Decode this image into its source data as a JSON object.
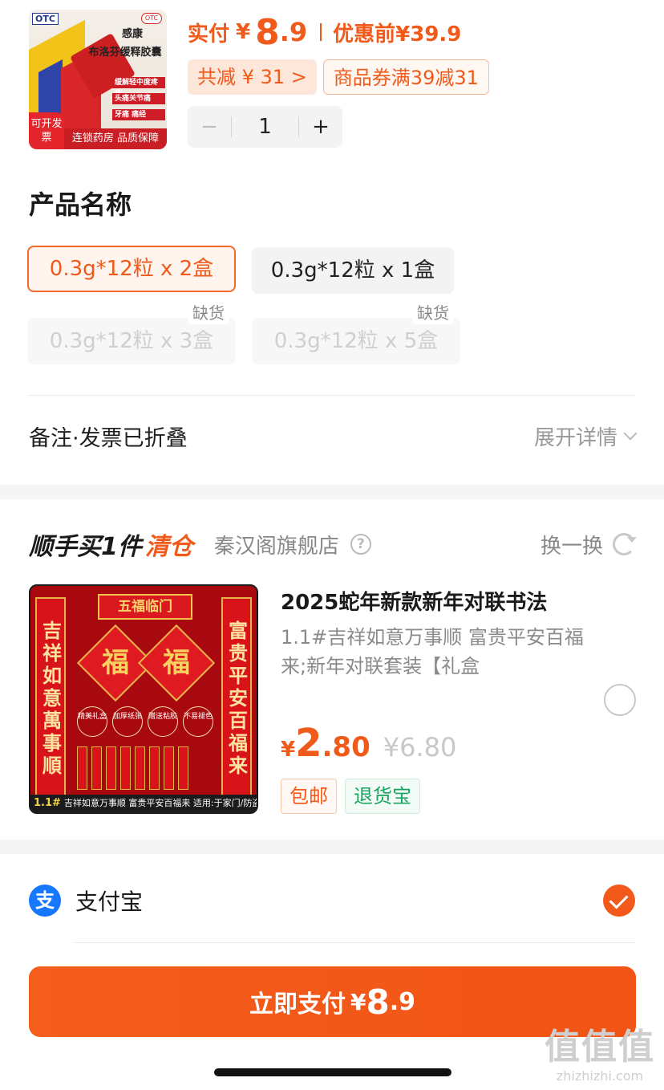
{
  "product": {
    "thumb": {
      "otc": "OTC",
      "brand": "感康",
      "name": "布洛芬缓释胶囊",
      "tags": [
        "缓解轻中度疼痛",
        "头痛关节痛",
        "牙痛 痛经"
      ],
      "invoice": "可开发票",
      "bottom_text": "连锁药房 品质保障"
    },
    "paid_label": "实付",
    "currency": "¥",
    "paid_int": "8",
    "paid_dec": ".9",
    "original_label": "优惠前¥39.9",
    "discounts": [
      "共减 ¥ 31 >",
      "商品券满39减31"
    ],
    "quantity": "1",
    "minus": "−",
    "plus": "+"
  },
  "spec": {
    "title": "产品名称",
    "options": [
      {
        "label": "0.3g*12粒 x 2盒",
        "state": "selected"
      },
      {
        "label": "0.3g*12粒 x 1盒",
        "state": "normal"
      },
      {
        "label": "0.3g*12粒 x 3盒",
        "state": "disabled",
        "stock": "缺货"
      },
      {
        "label": "0.3g*12粒 x 5盒",
        "state": "disabled",
        "stock": "缺货"
      }
    ]
  },
  "remark": {
    "label": "备注·发票已折叠",
    "expand": "展开详情"
  },
  "addon": {
    "title": "顺手买1件",
    "highlight": "清仓",
    "store": "秦汉阁旗舰店",
    "swap": "换一换",
    "image": {
      "banner": "五福临门",
      "left_couplet": "吉祥如意萬事順",
      "right_couplet": "富贵平安百福来",
      "fu": "福",
      "features": [
        "精美礼盒",
        "加厚纸张",
        "赠送粘胶",
        "不易褪色"
      ],
      "footer_tag": "1.1#",
      "footer_text": "吉祥如意万事顺 富贵平安百福来 适用:于家门/防盗门"
    },
    "name": "2025蛇年新款新年对联书法",
    "desc": "1.1#吉祥如意万事顺 富贵平安百福来;新年对联套装【礼盒",
    "price_yen": "¥",
    "price_int": "2",
    "price_dec": ".80",
    "price_orig": "¥6.80",
    "badges": [
      "包邮",
      "退货宝"
    ]
  },
  "payment": {
    "method": "支付宝",
    "icon_char": "支",
    "button_text": "立即支付",
    "button_yen": "¥",
    "button_int": "8",
    "button_dec": ".9"
  },
  "watermark": {
    "chars": "值值值",
    "url": "zhizhizhi.com"
  },
  "colors": {
    "accent": "#f05a1a",
    "alipay": "#1677ff",
    "green": "#1aa261"
  }
}
